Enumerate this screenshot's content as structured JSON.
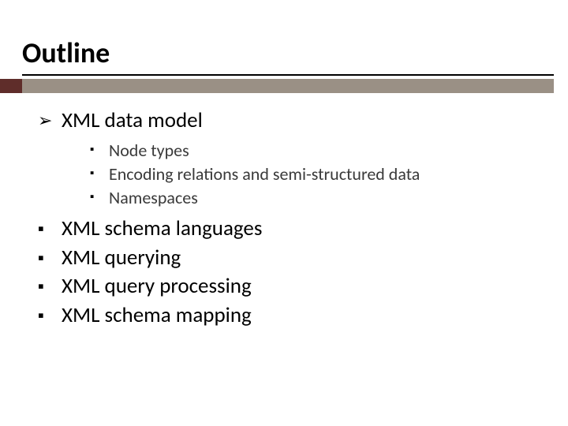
{
  "title": "Outline",
  "items": [
    {
      "bullet": "➢",
      "label": "XML data model",
      "children": [
        {
          "bullet": "▪",
          "label": "Node types"
        },
        {
          "bullet": "▪",
          "label": "Encoding relations and semi-structured data"
        },
        {
          "bullet": "▪",
          "label": "Namespaces"
        }
      ]
    },
    {
      "bullet": "▪",
      "label": "XML schema languages"
    },
    {
      "bullet": "▪",
      "label": "XML querying"
    },
    {
      "bullet": "▪",
      "label": "XML query processing"
    },
    {
      "bullet": "▪",
      "label": "XML schema mapping"
    }
  ],
  "colors": {
    "accent_dark": "#5f2d2a",
    "accent_light": "#9a9085"
  }
}
